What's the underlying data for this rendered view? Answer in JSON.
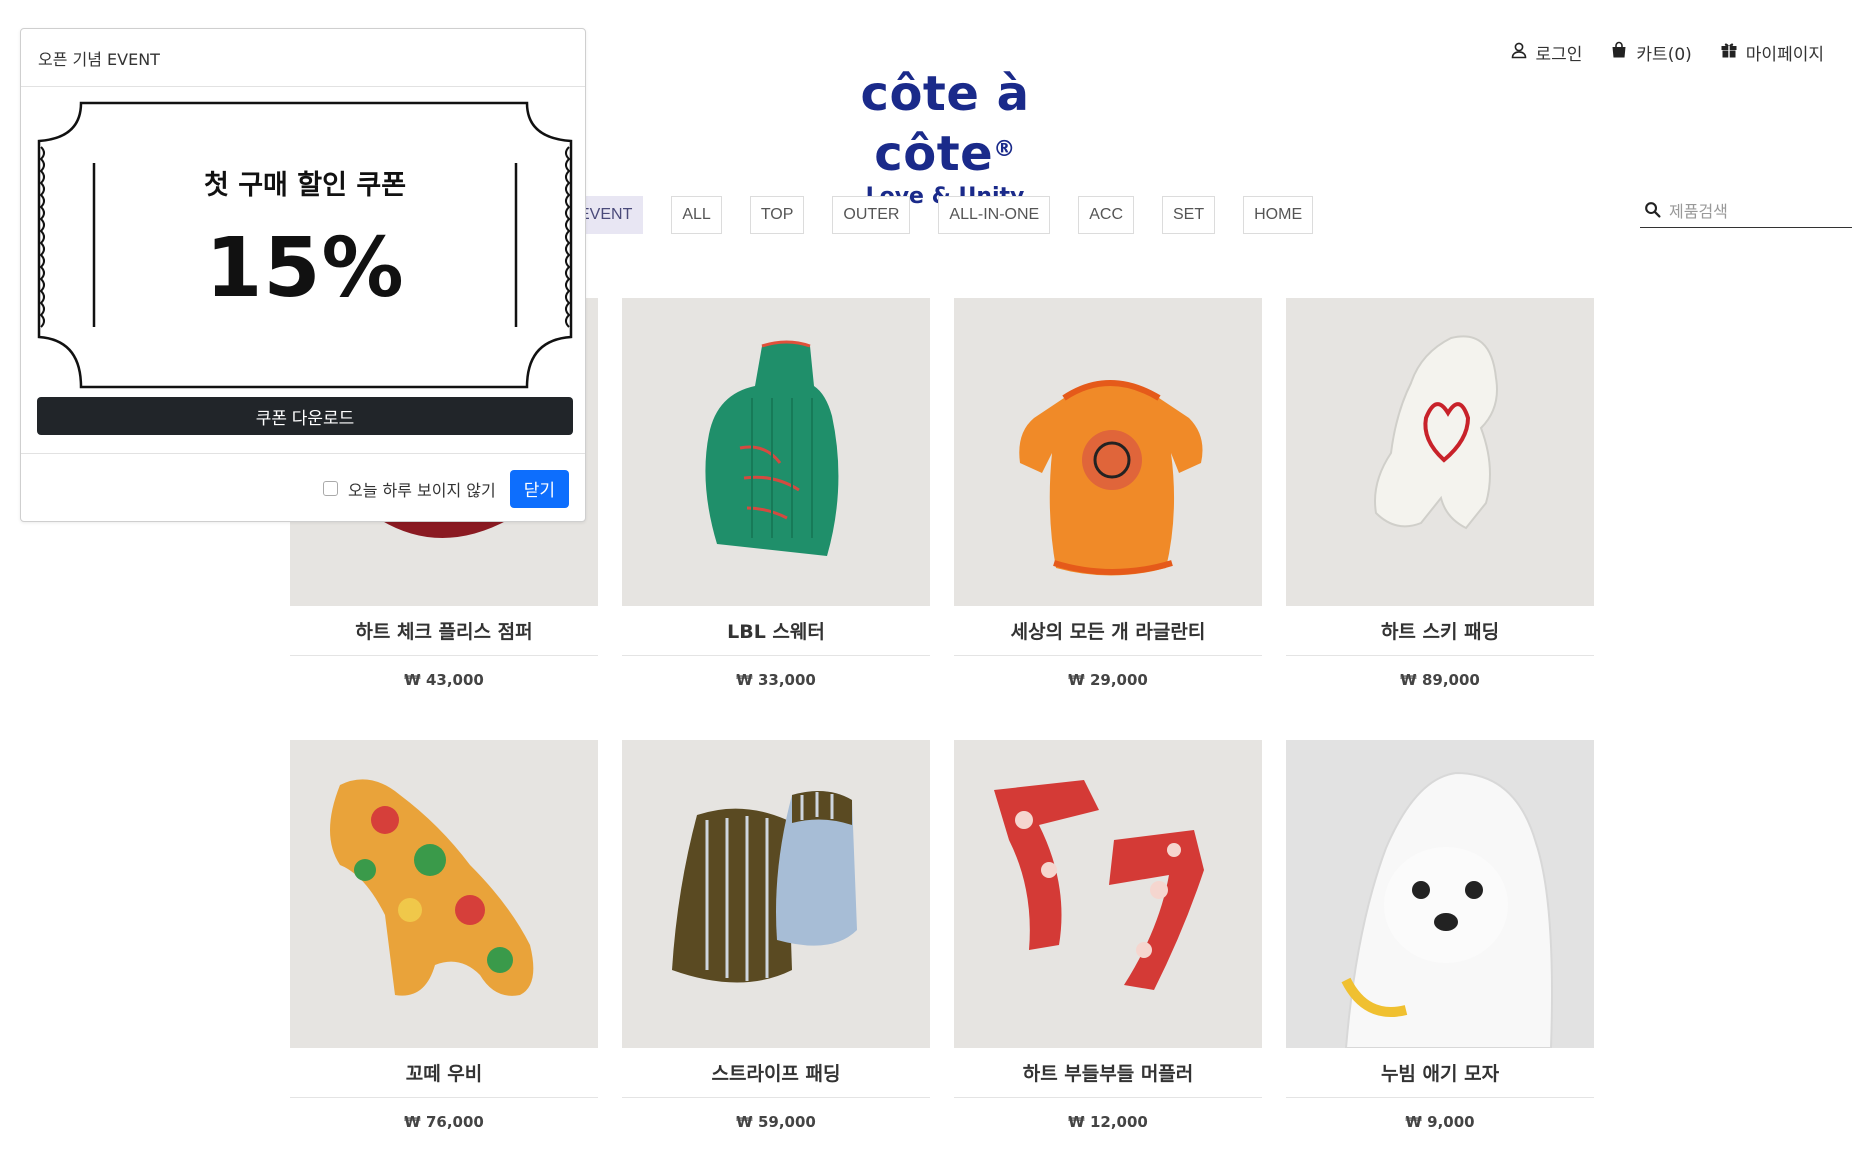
{
  "header": {
    "utils": [
      {
        "label": "로그인",
        "icon": "user-icon"
      },
      {
        "label": "카트(0)",
        "icon": "bag-icon"
      },
      {
        "label": "마이페이지",
        "icon": "gift-icon"
      }
    ],
    "logo_main": "côte à côte",
    "logo_mark": "®",
    "logo_sub": "Love & Unity",
    "search_placeholder": "제품검색"
  },
  "nav": {
    "items": [
      "EVENT",
      "ALL",
      "TOP",
      "OUTER",
      "ALL-IN-ONE",
      "ACC",
      "SET",
      "HOME"
    ],
    "active": "EVENT"
  },
  "products": [
    {
      "name": "하트 체크 플리스 점퍼",
      "price": "₩ 43,000"
    },
    {
      "name": "LBL 스웨터",
      "price": "₩ 33,000"
    },
    {
      "name": "세상의 모든 개 라글란티",
      "price": "₩ 29,000"
    },
    {
      "name": "하트 스키 패딩",
      "price": "₩ 89,000"
    },
    {
      "name": "꼬떼 우비",
      "price": "₩ 76,000"
    },
    {
      "name": "스트라이프 패딩",
      "price": "₩ 59,000"
    },
    {
      "name": "하트 부들부들 머플러",
      "price": "₩ 12,000"
    },
    {
      "name": "누빔 애기 모자",
      "price": "₩ 9,000"
    }
  ],
  "popup": {
    "title": "오픈 기념 EVENT",
    "coupon_text": "첫 구매 할인 쿠폰",
    "coupon_percent": "15%",
    "download_label": "쿠폰 다운로드",
    "hide_today_label": "오늘 하루 보이지 않기",
    "close_label": "닫기"
  },
  "colors": {
    "brand": "#1a2a8a",
    "primary_button": "#0d6efd",
    "dark_button": "#212529",
    "nav_active_bg": "#e8e6f3",
    "thumb_bg": "#e6e4e1"
  }
}
